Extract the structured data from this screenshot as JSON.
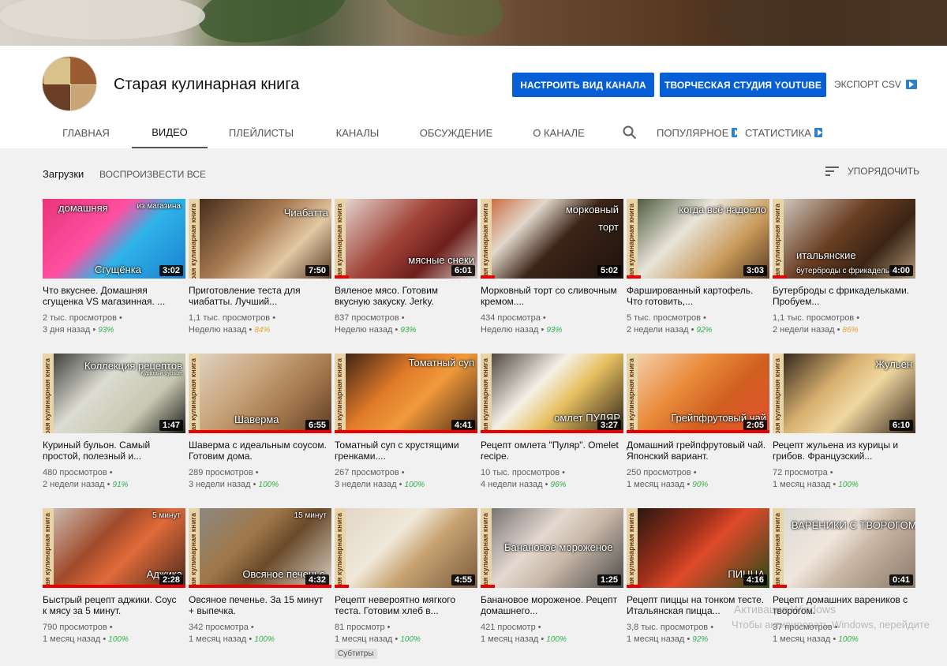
{
  "channel": {
    "name": "Старая кулинарная книга",
    "customize_button": "НАСТРОИТЬ ВИД КАНАЛА",
    "studio_button": "ТВОРЧЕСКАЯ СТУДИЯ YOUTUBE",
    "export_label": "ЭКСПОРТ CSV"
  },
  "tabs": {
    "home": "ГЛАВНАЯ",
    "videos": "ВИДЕО",
    "playlists": "ПЛЕЙЛИСТЫ",
    "channels": "КАНАЛЫ",
    "discussion": "ОБСУЖДЕНИЕ",
    "about": "О КАНАЛЕ",
    "popular": "ПОПУЛЯРНОЕ",
    "stats": "СТАТИСТИКА",
    "search_icon": "search-icon"
  },
  "toolbar": {
    "uploads": "Загрузки",
    "play_all": "ВОСПРОИЗВЕСТИ ВСЕ",
    "sort": "УПОРЯДОЧИТЬ",
    "sort_icon": "sort-icon"
  },
  "strip_text": "Старая кулинарная книга",
  "videos": [
    {
      "title": "Что вкуснее. Домашняя сгущенка VS магазинная. ...",
      "views": "2 тыс. просмотров",
      "age": "3 дня назад",
      "rating": "93%",
      "rating_color": "#31b24b",
      "duration": "3:02",
      "overlay": "Сгущёнка",
      "overlay2": "домашняя",
      "overlay3": "из магазина",
      "progress": 0
    },
    {
      "title": "Приготовление теста для чиабатты. Лучший...",
      "views": "1,1 тыс. просмотров",
      "age": "Неделю назад",
      "rating": "84%",
      "rating_color": "#f0a030",
      "duration": "7:50",
      "overlay": "Чиабатта",
      "progress": 0
    },
    {
      "title": "Вяленое мясо. Готовим вкусную закуску. Jerky.",
      "views": "837 просмотров",
      "age": "Неделю назад",
      "rating": "93%",
      "rating_color": "#31b24b",
      "duration": "6:01",
      "overlay": "мясные снеки",
      "progress": 0.1
    },
    {
      "title": "Морковный торт со сливочным кремом....",
      "views": "434 просмотра",
      "age": "Неделю назад",
      "rating": "93%",
      "rating_color": "#31b24b",
      "duration": "5:02",
      "overlay": "морковный",
      "overlay2": "торт",
      "progress": 0.1
    },
    {
      "title": "Фаршированный картофель. Что готовить,...",
      "views": "5 тыс. просмотров",
      "age": "2 недели назад",
      "rating": "92%",
      "rating_color": "#31b24b",
      "duration": "3:03",
      "overlay": "когда всё надоело",
      "progress": 0.1
    },
    {
      "title": "Бутерброды с фрикадельками. Пробуем...",
      "views": "1,1 тыс. просмотров",
      "age": "2 недели назад",
      "rating": "86%",
      "rating_color": "#f0a030",
      "duration": "4:00",
      "overlay": "итальянские",
      "overlay2": "бутерброды с фрикадельками",
      "progress": 0.1
    },
    {
      "title": "Куриный бульон. Самый простой, полезный и...",
      "views": "480 просмотров",
      "age": "2 недели назад",
      "rating": "91%",
      "rating_color": "#31b24b",
      "duration": "1:47",
      "overlay": "Коллекция рецептов",
      "overlay2": "Куриный бульон",
      "progress": 0
    },
    {
      "title": "Шаверма с идеальным соусом. Готовим дома.",
      "views": "289 просмотров",
      "age": "3 недели назад",
      "rating": "100%",
      "rating_color": "#31b24b",
      "duration": "6:55",
      "overlay": "Шаверма",
      "progress": 1
    },
    {
      "title": "Томатный суп с хрустящими гренками....",
      "views": "267 просмотров",
      "age": "3 недели назад",
      "rating": "100%",
      "rating_color": "#31b24b",
      "duration": "4:41",
      "overlay": "Томатный суп",
      "progress": 1
    },
    {
      "title": "Рецепт омлета \"Пуляр\". Omelet recipe.",
      "views": "10 тыс. просмотров",
      "age": "4 недели назад",
      "rating": "96%",
      "rating_color": "#31b24b",
      "duration": "3:27",
      "overlay": "омлет ПУЛЯР",
      "progress": 1
    },
    {
      "title": "Домашний грейпфрутовый чай. Японский вариант.",
      "views": "250 просмотров",
      "age": "1 месяц назад",
      "rating": "90%",
      "rating_color": "#31b24b",
      "duration": "2:05",
      "overlay": "Грейпфрутовый чай",
      "progress": 1
    },
    {
      "title": "Рецепт жульена из курицы и грибов. Французский...",
      "views": "72 просмотра",
      "age": "1 месяц назад",
      "rating": "100%",
      "rating_color": "#31b24b",
      "duration": "6:10",
      "overlay": "Жульен",
      "progress": 0
    },
    {
      "title": "Быстрый рецепт аджики. Соус к мясу за 5 минут.",
      "views": "790 просмотров",
      "age": "1 месяц назад",
      "rating": "100%",
      "rating_color": "#31b24b",
      "duration": "2:28",
      "overlay": "Аджика",
      "overlay2": "5 минут",
      "progress": 1
    },
    {
      "title": "Овсяное печенье. За 15 минут + выпечка.",
      "views": "342 просмотра",
      "age": "1 месяц назад",
      "rating": "100%",
      "rating_color": "#31b24b",
      "duration": "4:32",
      "overlay": "Овсяное печенье",
      "overlay2": "15 минут",
      "progress": 1
    },
    {
      "title": "Рецепт невероятно мягкого теста. Готовим хлеб в...",
      "views": "81 просмотр",
      "age": "1 месяц назад",
      "rating": "100%",
      "rating_color": "#31b24b",
      "duration": "4:55",
      "overlay": "",
      "progress": 0.1,
      "badge": "Субтитры"
    },
    {
      "title": "Банановое мороженое. Рецепт домашнего...",
      "views": "421 просмотр",
      "age": "1 месяц назад",
      "rating": "100%",
      "rating_color": "#31b24b",
      "duration": "1:25",
      "overlay": "Банановое мороженое",
      "progress": 0.1
    },
    {
      "title": "Рецепт пиццы на тонком тесте. Итальянская пицца...",
      "views": "3,8 тыс. просмотров",
      "age": "1 месяц назад",
      "rating": "92%",
      "rating_color": "#31b24b",
      "duration": "4:16",
      "overlay": "ПИЦЦА",
      "progress": 0.1
    },
    {
      "title": "Рецепт домашних вареников с творогом.",
      "views": "37 просмотров",
      "age": "1 месяц назад",
      "rating": "100%",
      "rating_color": "#31b24b",
      "duration": "0:41",
      "overlay": "ВАРЕНИКИ С ТВОРОГОМ",
      "progress": 0.1
    }
  ],
  "watermark": {
    "line1": "Активация Windows",
    "line2": "Чтобы активировать Windows, перейдите"
  }
}
